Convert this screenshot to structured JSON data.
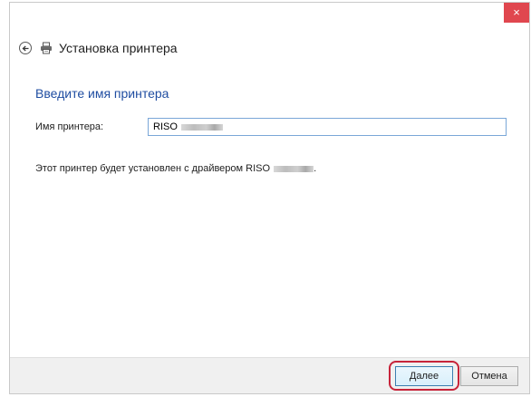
{
  "window": {
    "title": "Установка принтера",
    "close_label": "×"
  },
  "page": {
    "heading": "Введите имя принтера",
    "field_label": "Имя принтера:",
    "printer_name_value": "RISO",
    "info_prefix": "Этот принтер будет установлен с драйвером RISO",
    "info_suffix": "."
  },
  "footer": {
    "next_label": "Далее",
    "cancel_label": "Отмена"
  },
  "icons": {
    "back": "back-arrow-icon",
    "printer": "printer-icon",
    "close": "close-icon"
  },
  "colors": {
    "heading": "#1f4da1",
    "close_button": "#e0474f",
    "highlight": "#c7243a"
  }
}
